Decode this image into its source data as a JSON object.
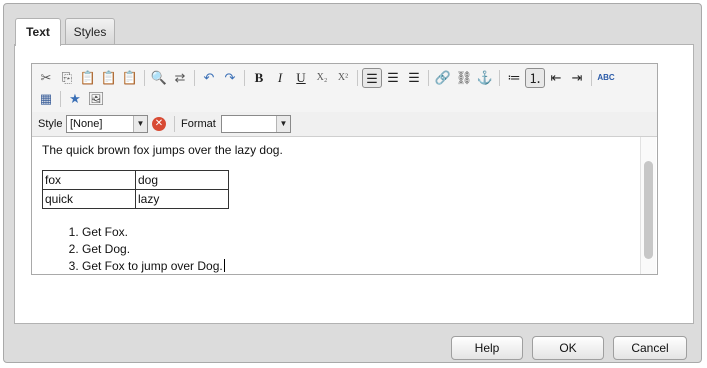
{
  "tabs": [
    {
      "label": "Text",
      "active": true
    },
    {
      "label": "Styles",
      "active": false
    }
  ],
  "toolbar": {
    "row1": [
      {
        "name": "cut-icon",
        "glyph": "✂"
      },
      {
        "name": "copy-icon",
        "glyph": "⎘"
      },
      {
        "name": "paste-icon",
        "glyph": "📋"
      },
      {
        "name": "paste-text-icon",
        "glyph": "📋"
      },
      {
        "name": "paste-word-icon",
        "glyph": "📋"
      },
      {
        "name": "find-icon",
        "glyph": "🔍"
      },
      {
        "name": "replace-icon",
        "glyph": "⇄"
      },
      {
        "name": "undo-icon",
        "glyph": "↶"
      },
      {
        "name": "redo-icon",
        "glyph": "↷"
      },
      {
        "name": "bold-icon",
        "glyph": "B"
      },
      {
        "name": "italic-icon",
        "glyph": "I"
      },
      {
        "name": "underline-icon",
        "glyph": "U"
      },
      {
        "name": "subscript-icon",
        "glyph": "X₂"
      },
      {
        "name": "superscript-icon",
        "glyph": "X²"
      },
      {
        "name": "align-left-icon",
        "glyph": "☰"
      },
      {
        "name": "align-center-icon",
        "glyph": "☰"
      },
      {
        "name": "align-right-icon",
        "glyph": "☰"
      },
      {
        "name": "link-icon",
        "glyph": "🔗"
      },
      {
        "name": "unlink-icon",
        "glyph": "⛓"
      },
      {
        "name": "anchor-icon",
        "glyph": "⚓"
      },
      {
        "name": "bulleted-list-icon",
        "glyph": "≔"
      },
      {
        "name": "numbered-list-icon",
        "glyph": "⒈"
      },
      {
        "name": "outdent-icon",
        "glyph": "⇤"
      },
      {
        "name": "indent-icon",
        "glyph": "⇥"
      },
      {
        "name": "spellcheck-icon",
        "glyph": "ABC"
      }
    ],
    "row2": [
      {
        "name": "table-icon",
        "glyph": "▦"
      },
      {
        "name": "special-character-icon",
        "glyph": "★"
      },
      {
        "name": "image-icon",
        "glyph": "🖼"
      }
    ]
  },
  "format_bar": {
    "style_label": "Style",
    "style_value": "[None]",
    "format_label": "Format",
    "format_value": ""
  },
  "content": {
    "paragraph": "The quick brown fox jumps over the lazy dog.",
    "table": [
      [
        "fox",
        "dog"
      ],
      [
        "quick",
        "lazy"
      ]
    ],
    "list": [
      "Get Fox.",
      "Get Dog.",
      "Get Fox to jump over Dog."
    ]
  },
  "buttons": {
    "help": "Help",
    "ok": "OK",
    "cancel": "Cancel"
  },
  "colors": {
    "dialog_bg": "#dcdcdc",
    "clear_button": "#d84a33"
  }
}
